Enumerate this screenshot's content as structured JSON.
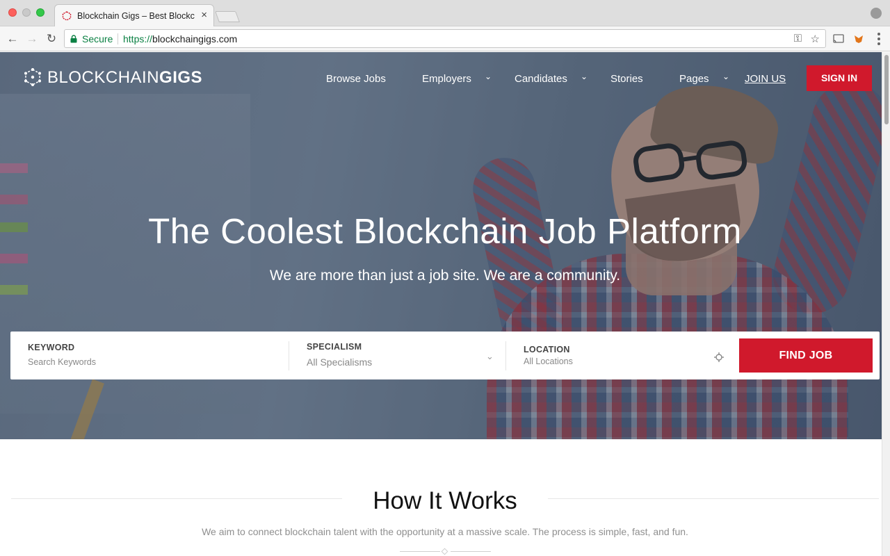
{
  "browser": {
    "tab_title": "Blockchain Gigs – Best Blockc",
    "tab_close": "×",
    "secure_label": "Secure",
    "url_scheme": "https://",
    "url_host": "blockchaingigs.com"
  },
  "header": {
    "logo_light": "BLOCKCHAIN",
    "logo_bold": "GIGS",
    "nav": {
      "browse_jobs": "Browse Jobs",
      "employers": "Employers",
      "candidates": "Candidates",
      "stories": "Stories",
      "pages": "Pages",
      "join_us": "JOIN US",
      "sign_in": "SIGN IN"
    }
  },
  "hero": {
    "title": "The Coolest Blockchain Job Platform",
    "subtitle": "We are more than just a job site. We are a community."
  },
  "search": {
    "keyword_label": "KEYWORD",
    "keyword_placeholder": "Search Keywords",
    "specialism_label": "SPECIALISM",
    "specialism_value": "All Specialisms",
    "location_label": "LOCATION",
    "location_value": "All Locations",
    "submit_label": "FIND JOB"
  },
  "how_it_works": {
    "title": "How It Works",
    "subtitle": "We aim to connect blockchain talent with the opportunity at a massive scale. The process is simple, fast, and fun."
  },
  "colors": {
    "accent": "#d0192c",
    "secure_green": "#0b8043"
  },
  "icons": [
    "logo-mark-icon",
    "lock-icon",
    "key-icon",
    "star-icon",
    "cast-icon",
    "fox-extension-icon",
    "menu-icon",
    "chevron-down-icon",
    "crosshair-icon",
    "profile-icon"
  ]
}
